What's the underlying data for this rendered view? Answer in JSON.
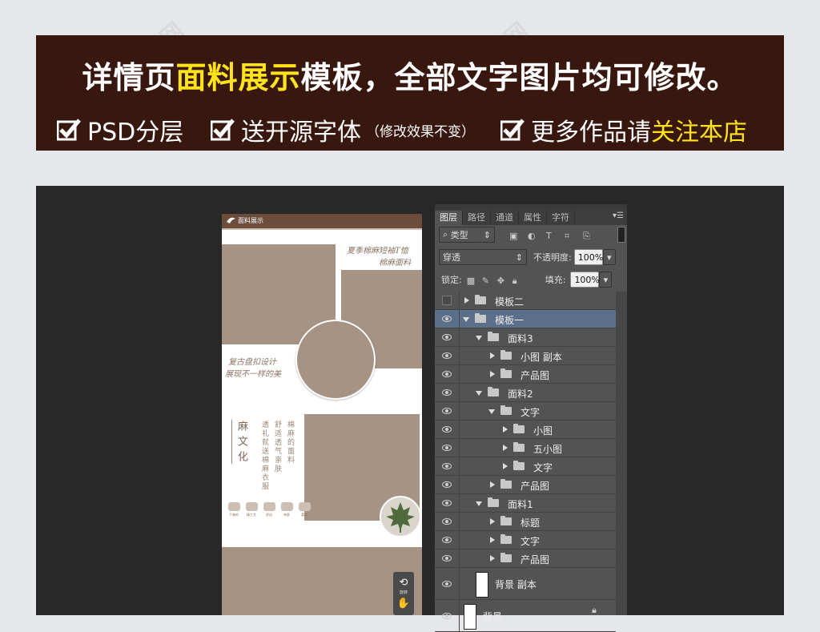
{
  "banner": {
    "title_pre": "详情页",
    "title_hl": "面料展示",
    "title_post": "模板，全部文字图片均可修改。",
    "features": [
      {
        "main": "PSD分层",
        "small": ""
      },
      {
        "main": "送开源字体",
        "small": "（修改效果不变）"
      },
      {
        "main": "更多作品请",
        "hl": "关注本店"
      }
    ]
  },
  "document": {
    "header": "面料展示",
    "text_top_line1": "夏季棉麻短袖T恤",
    "text_top_line2": "棉麻面料",
    "text_mid_line1": "复古盘扣设计",
    "text_mid_line2": "展现不一样的美",
    "vtitle": "麻文化",
    "vcol1": "透礼就送棉麻衣服",
    "vcol2": "舒适透气亲肤",
    "vcol3": "棉麻的面料",
    "icons": [
      "干爽的",
      "精工艺",
      "舒适",
      "亲肤",
      "柔软"
    ],
    "tool_rotate": "旋转"
  },
  "panel": {
    "tabs": [
      "图层",
      "路径",
      "通道",
      "属性",
      "字符"
    ],
    "filter_kind": "类型",
    "blend_mode": "穿透",
    "opacity_label": "不透明度:",
    "opacity_value": "100%",
    "lock_label": "锁定:",
    "fill_label": "填充:",
    "fill_value": "100%"
  },
  "layers": [
    {
      "name": "模板二",
      "visible": false
    },
    {
      "name": "模板一",
      "visible": true,
      "selected": true
    },
    {
      "name": "面料3",
      "visible": true
    },
    {
      "name": "小图 副本",
      "visible": true
    },
    {
      "name": "产品图",
      "visible": true
    },
    {
      "name": "面料2",
      "visible": true
    },
    {
      "name": "文字",
      "visible": true
    },
    {
      "name": "小图",
      "visible": true
    },
    {
      "name": "五小图",
      "visible": true
    },
    {
      "name": "文字",
      "visible": true
    },
    {
      "name": "产品图",
      "visible": true
    },
    {
      "name": "面料1",
      "visible": true
    },
    {
      "name": "标题",
      "visible": true
    },
    {
      "name": "文字",
      "visible": true
    },
    {
      "name": "产品图",
      "visible": true
    },
    {
      "name": "背景 副本",
      "visible": true
    },
    {
      "name": "背景",
      "visible": true
    }
  ],
  "colors": {
    "banner_bg": "#38170f",
    "highlight": "#ffe41b",
    "fabric_tan": "#a69383",
    "panel_bg": "#535353",
    "selection": "#5c6f8a"
  }
}
